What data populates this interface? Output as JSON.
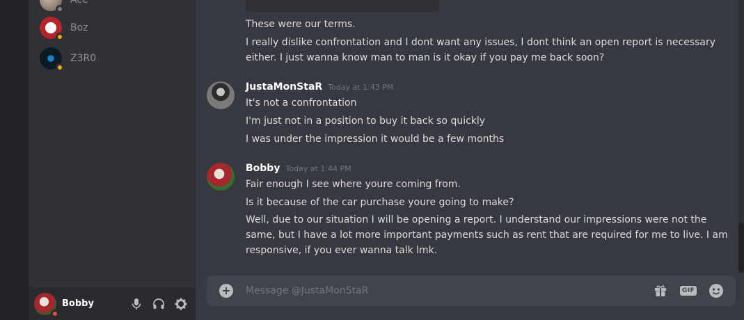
{
  "dm_list": [
    {
      "name": "Ace",
      "status": "offline"
    },
    {
      "name": "Boz",
      "status": "idle"
    },
    {
      "name": "Z3R0",
      "status": "idle"
    }
  ],
  "user_panel": {
    "username": "Bobby",
    "status": "dnd",
    "icons": [
      "microphone-icon",
      "headphones-icon",
      "settings-gear-icon"
    ]
  },
  "messages": {
    "continued": [
      "These were our terms.",
      "I really dislike confrontation and I dont want any issues, I dont think an open report is necessary",
      "either. I just wanna know man to man is it okay if you pay me back soon?"
    ],
    "group1": {
      "author": "JustaMonStaR",
      "timestamp": "Today at 1:43 PM",
      "lines": [
        "It's not a confrontation",
        "I'm just not in a position to buy it back so quickly",
        "I was under the impression it would be a few months"
      ]
    },
    "group2": {
      "author": "Bobby",
      "timestamp": "Today at 1:44 PM",
      "lines": [
        "Fair enough I see where youre coming from.",
        "Is it because of the car purchase youre going to make?",
        "Well, due to our situation I will be opening a report. I understand our impressions were not the",
        "same, but I have a lot more important payments such as rent that are required for me to live. I am",
        "responsive, if you ever wanna talk lmk."
      ]
    }
  },
  "composer": {
    "placeholder": "Message @JustaMonStaR",
    "gif_label": "GIF",
    "icons": [
      "attach-plus-icon",
      "gift-icon",
      "gif-icon",
      "emoji-icon"
    ]
  },
  "colors": {
    "background": "#36393f",
    "sidebar": "#2f3136",
    "idle": "#faa61a",
    "dnd": "#f04747"
  }
}
